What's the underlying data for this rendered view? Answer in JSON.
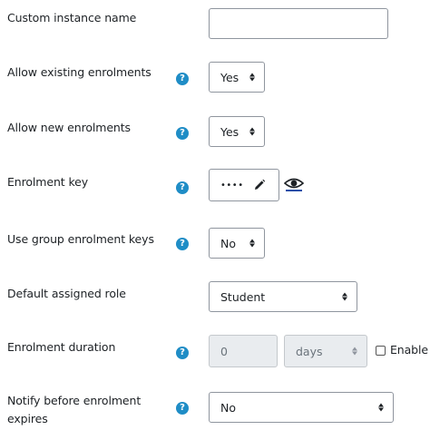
{
  "fields": {
    "custom_name": {
      "label": "Custom instance name",
      "value": ""
    },
    "allow_existing": {
      "label": "Allow existing enrolments",
      "value": "Yes"
    },
    "allow_new": {
      "label": "Allow new enrolments",
      "value": "Yes"
    },
    "enrol_key": {
      "label": "Enrolment key",
      "value": "••••"
    },
    "group_keys": {
      "label": "Use group enrolment keys",
      "value": "No"
    },
    "default_role": {
      "label": "Default assigned role",
      "value": "Student"
    },
    "duration": {
      "label": "Enrolment duration",
      "value": "0",
      "unit": "days",
      "enable_label": "Enable",
      "enabled": false
    },
    "notify": {
      "label": "Notify before enrolment expires",
      "value": "No"
    }
  },
  "icons": {
    "help": "question-circle-icon",
    "edit": "pencil-icon",
    "reveal": "eye-icon"
  },
  "colors": {
    "help": "#1f8dc6",
    "border": "#8f959e",
    "disabled_bg": "#e9ecef"
  }
}
